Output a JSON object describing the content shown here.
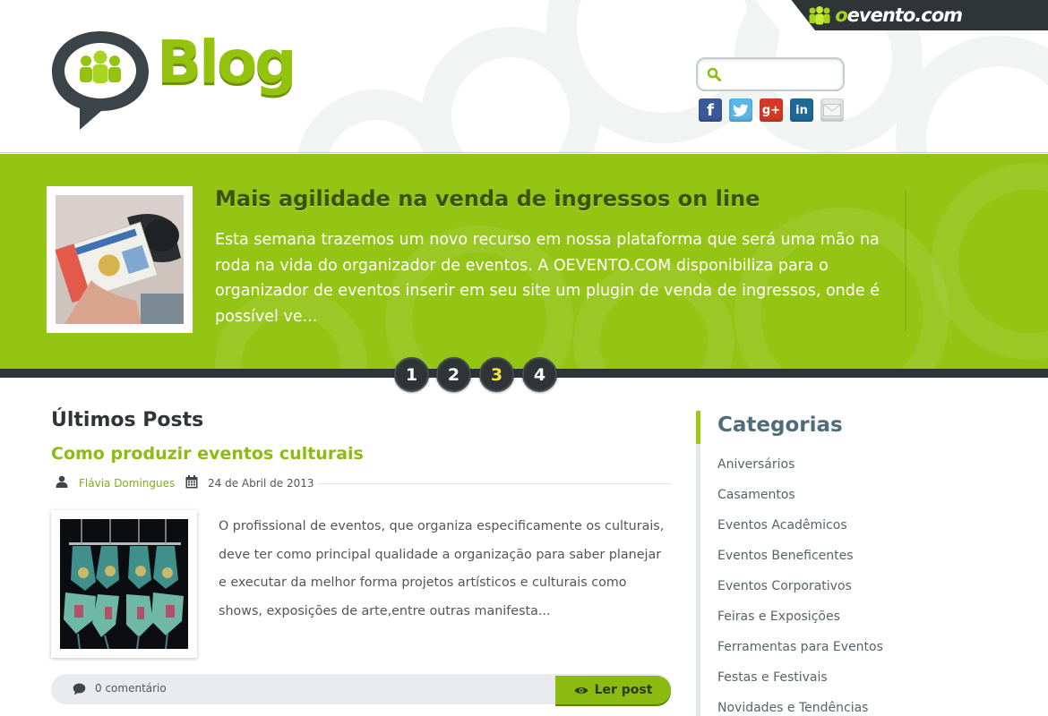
{
  "brand": {
    "site_prefix": "o",
    "site_rest": "evento.com"
  },
  "header": {
    "logo_text": "Blog",
    "search": {
      "placeholder": ""
    },
    "social": [
      "facebook",
      "twitter",
      "google-plus",
      "linkedin",
      "email"
    ]
  },
  "featured": {
    "title": "Mais agilidade na venda de ingressos on line",
    "excerpt": "Esta semana trazemos um novo recurso em nossa plataforma que será uma mão na roda na vida do organizador de eventos. A OEVENTO.COM disponibiliza para o organizador de eventos inserir em seu site um plugin de venda de ingressos, onde é possível ve...",
    "pages": [
      "1",
      "2",
      "3",
      "4"
    ],
    "active_page": 3
  },
  "main": {
    "section_title": "Últimos Posts",
    "post": {
      "title": "Como produzir eventos culturais",
      "author": "Flávia Domingues",
      "date": "24 de Abril de 2013",
      "excerpt": "O profissional de eventos, que organiza especificamente os culturais, deve ter como principal qualidade a organização para saber planejar e executar da melhor forma projetos artísticos e culturais como shows, exposições de arte,entre outras manifesta...",
      "comments": "0 comentário",
      "read_label": "Ler post"
    }
  },
  "sidebar": {
    "title": "Categorias",
    "categories": [
      "Aniversários",
      "Casamentos",
      "Eventos Acadêmicos",
      "Eventos Beneficentes",
      "Eventos Corporativos",
      "Feiras e Exposições",
      "Ferramentas para Eventos",
      "Festas e Festivais",
      "Novidades e Tendências"
    ]
  },
  "colors": {
    "brand_green": "#94c414",
    "dark": "#2f3437",
    "sidebar_title": "#516c79",
    "link_green": "#8cbc11",
    "active_page": "#f4e33a"
  }
}
